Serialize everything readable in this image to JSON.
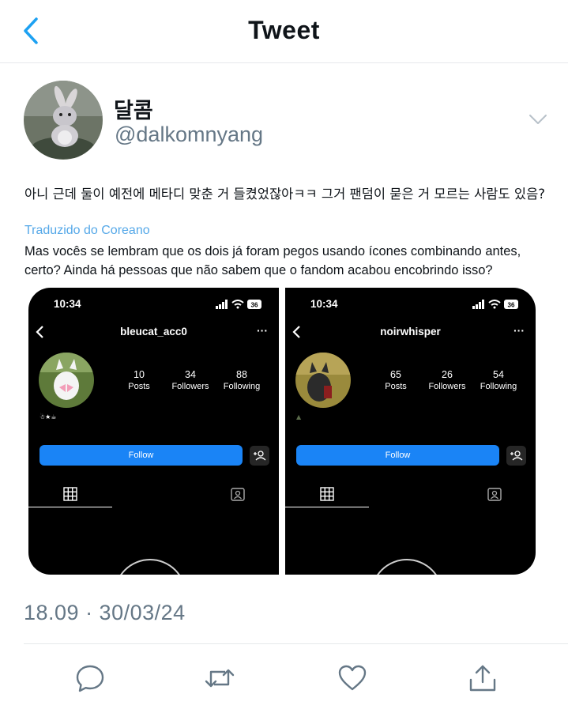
{
  "header": {
    "title": "Tweet",
    "back_icon": "chevron-left-icon"
  },
  "author": {
    "display_name": "달콤",
    "handle": "@dalkomnyang",
    "avatar": "rabbit-avatar-image"
  },
  "tweet": {
    "text": "아니 근데 둘이 예전에 메타디 맞춘 거 들켰었잖아ㅋㅋ 그거 팬덤이 묻은 거 모르는 사람도 있음?",
    "translation_label": "Traduzido do Coreano",
    "translation_text": "Mas vocês se lembram que os dois já foram pegos usando ícones combinando antes, certo? Ainda há pessoas que não sabem que o fandom acabou encobrindo isso?",
    "timestamp": "18.09 · 30/03/24"
  },
  "media": [
    {
      "time": "10:34",
      "battery": "36",
      "username": "bleucat_acc0",
      "more": "···",
      "stats": [
        {
          "value": "10",
          "label": "Posts"
        },
        {
          "value": "34",
          "label": "Followers"
        },
        {
          "value": "88",
          "label": "Following"
        }
      ],
      "bio": "☃★☕",
      "follow_label": "Follow"
    },
    {
      "time": "10:34",
      "battery": "36",
      "username": "noirwhisper",
      "more": "···",
      "stats": [
        {
          "value": "65",
          "label": "Posts"
        },
        {
          "value": "26",
          "label": "Followers"
        },
        {
          "value": "54",
          "label": "Following"
        }
      ],
      "bio": "▲",
      "follow_label": "Follow"
    }
  ],
  "actions": [
    "reply-icon",
    "retweet-icon",
    "like-icon",
    "share-icon"
  ],
  "colors": {
    "accent": "#1da1f2",
    "translate_link": "#55a8e8",
    "muted": "#657786",
    "follow_button": "#1a84f6"
  }
}
